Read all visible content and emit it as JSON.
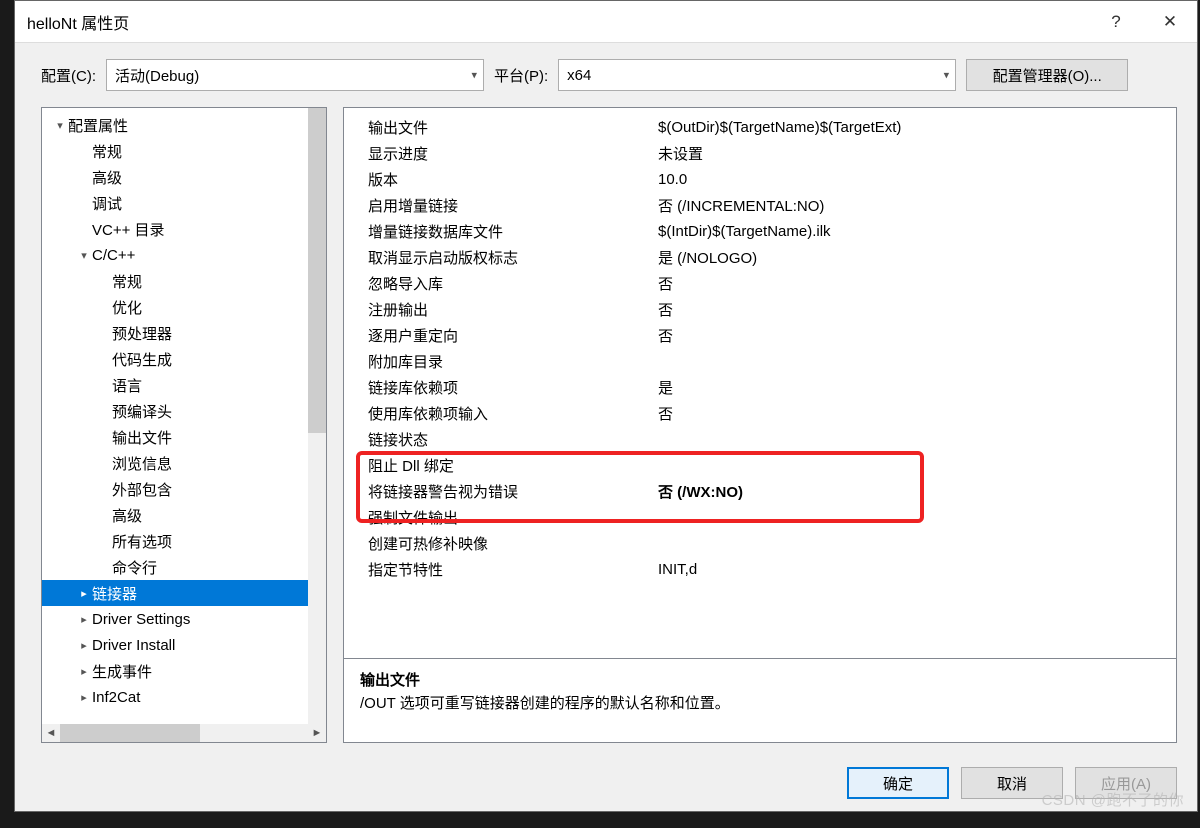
{
  "window": {
    "title": "helloNt 属性页"
  },
  "config_row": {
    "config_label": "配置(C):",
    "config_value": "活动(Debug)",
    "platform_label": "平台(P):",
    "platform_value": "x64",
    "manager": "配置管理器(O)..."
  },
  "tree": [
    {
      "label": "配置属性",
      "level": 0,
      "exp": "▾",
      "interact": true
    },
    {
      "label": "常规",
      "level": 1,
      "interact": true
    },
    {
      "label": "高级",
      "level": 1,
      "interact": true
    },
    {
      "label": "调试",
      "level": 1,
      "interact": true
    },
    {
      "label": "VC++ 目录",
      "level": 1,
      "interact": true
    },
    {
      "label": "C/C++",
      "level": 1,
      "exp": "▾",
      "interact": true
    },
    {
      "label": "常规",
      "level": 2,
      "interact": true
    },
    {
      "label": "优化",
      "level": 2,
      "interact": true
    },
    {
      "label": "预处理器",
      "level": 2,
      "interact": true
    },
    {
      "label": "代码生成",
      "level": 2,
      "interact": true
    },
    {
      "label": "语言",
      "level": 2,
      "interact": true
    },
    {
      "label": "预编译头",
      "level": 2,
      "interact": true
    },
    {
      "label": "输出文件",
      "level": 2,
      "interact": true
    },
    {
      "label": "浏览信息",
      "level": 2,
      "interact": true
    },
    {
      "label": "外部包含",
      "level": 2,
      "interact": true
    },
    {
      "label": "高级",
      "level": 2,
      "interact": true
    },
    {
      "label": "所有选项",
      "level": 2,
      "interact": true
    },
    {
      "label": "命令行",
      "level": 2,
      "interact": true
    },
    {
      "label": "链接器",
      "level": 1,
      "exp": "▸",
      "selected": true,
      "interact": true
    },
    {
      "label": "Driver Settings",
      "level": 1,
      "exp": "▸",
      "interact": true
    },
    {
      "label": "Driver Install",
      "level": 1,
      "exp": "▸",
      "interact": true
    },
    {
      "label": "生成事件",
      "level": 1,
      "exp": "▸",
      "interact": true
    },
    {
      "label": "Inf2Cat",
      "level": 1,
      "exp": "▸",
      "interact": true
    }
  ],
  "grid": [
    {
      "name": "输出文件",
      "value": "$(OutDir)$(TargetName)$(TargetExt)"
    },
    {
      "name": "显示进度",
      "value": "未设置"
    },
    {
      "name": "版本",
      "value": "10.0"
    },
    {
      "name": "启用增量链接",
      "value": "否 (/INCREMENTAL:NO)"
    },
    {
      "name": "增量链接数据库文件",
      "value": "$(IntDir)$(TargetName).ilk"
    },
    {
      "name": "取消显示启动版权标志",
      "value": "是 (/NOLOGO)"
    },
    {
      "name": "忽略导入库",
      "value": "否"
    },
    {
      "name": "注册输出",
      "value": "否"
    },
    {
      "name": "逐用户重定向",
      "value": "否"
    },
    {
      "name": "附加库目录",
      "value": ""
    },
    {
      "name": "链接库依赖项",
      "value": "是"
    },
    {
      "name": "使用库依赖项输入",
      "value": "否"
    },
    {
      "name": "链接状态",
      "value": ""
    },
    {
      "name": "阻止 Dll 绑定",
      "value": ""
    },
    {
      "name": "将链接器警告视为错误",
      "value": "否 (/WX:NO)",
      "bold": true
    },
    {
      "name": "强制文件输出",
      "value": ""
    },
    {
      "name": "创建可热修补映像",
      "value": ""
    },
    {
      "name": "指定节特性",
      "value": "INIT,d"
    }
  ],
  "desc": {
    "title": "输出文件",
    "text": "/OUT 选项可重写链接器创建的程序的默认名称和位置。"
  },
  "buttons": {
    "ok": "确定",
    "cancel": "取消",
    "apply": "应用(A)"
  },
  "watermark": "CSDN @跑不了的你"
}
